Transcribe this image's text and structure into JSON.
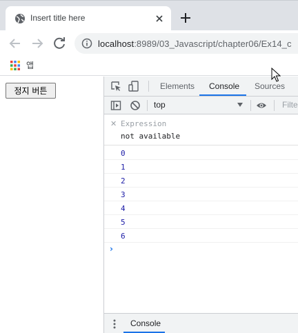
{
  "browser": {
    "tab": {
      "title": "Insert title here",
      "favicon": "globe-icon",
      "close_icon": "close-icon"
    },
    "new_tab_icon": "plus-icon",
    "toolbar": {
      "back_icon": "arrow-left-icon",
      "forward_icon": "arrow-right-icon",
      "reload_icon": "reload-icon",
      "info_icon": "info-icon",
      "url_host": "localhost",
      "url_rest": ":8989/03_Javascript/chapter06/Ex14_c"
    },
    "bookmarks": {
      "apps_label": "앱",
      "apps_icon": "apps-grid-icon"
    }
  },
  "page": {
    "stop_button_label": "정지 버튼"
  },
  "devtools": {
    "tabs": [
      {
        "label": "Elements",
        "active": false
      },
      {
        "label": "Console",
        "active": true
      },
      {
        "label": "Sources",
        "active": false
      }
    ],
    "toolbar": {
      "context": "top",
      "filter_placeholder": "Filte"
    },
    "watch": {
      "expression": "Expression",
      "value": "not available"
    },
    "console_output": [
      "0",
      "1",
      "2",
      "3",
      "4",
      "5",
      "6"
    ],
    "drawer": {
      "tab_label": "Console"
    }
  },
  "colors": {
    "accent": "#1a73e8",
    "console_number": "#1a1aa6",
    "tabstrip_bg": "#dee1e6",
    "devtools_bar": "#f1f3f4"
  }
}
